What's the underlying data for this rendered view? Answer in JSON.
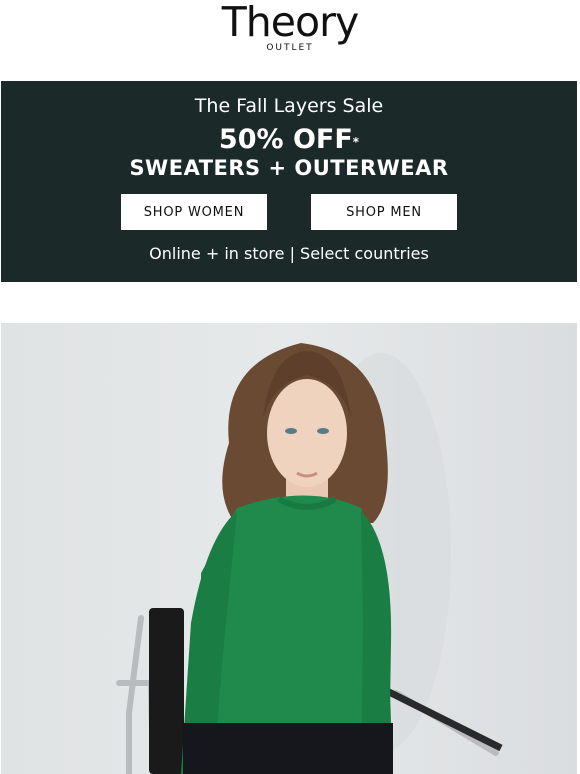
{
  "header": {
    "logo_main": "Theory",
    "logo_sub": "OUTLET"
  },
  "banner": {
    "title": "The Fall Layers Sale",
    "offer": "50% OFF",
    "offer_mark": "*",
    "categories": "SWEATERS + OUTERWEAR",
    "shop_women_label": "SHOP WOMEN",
    "shop_men_label": "SHOP MEN",
    "availability": "Online + in store | Select countries",
    "background_color": "#1b2a28"
  },
  "hero": {
    "subject": "model-in-green-sweater-on-chair"
  }
}
